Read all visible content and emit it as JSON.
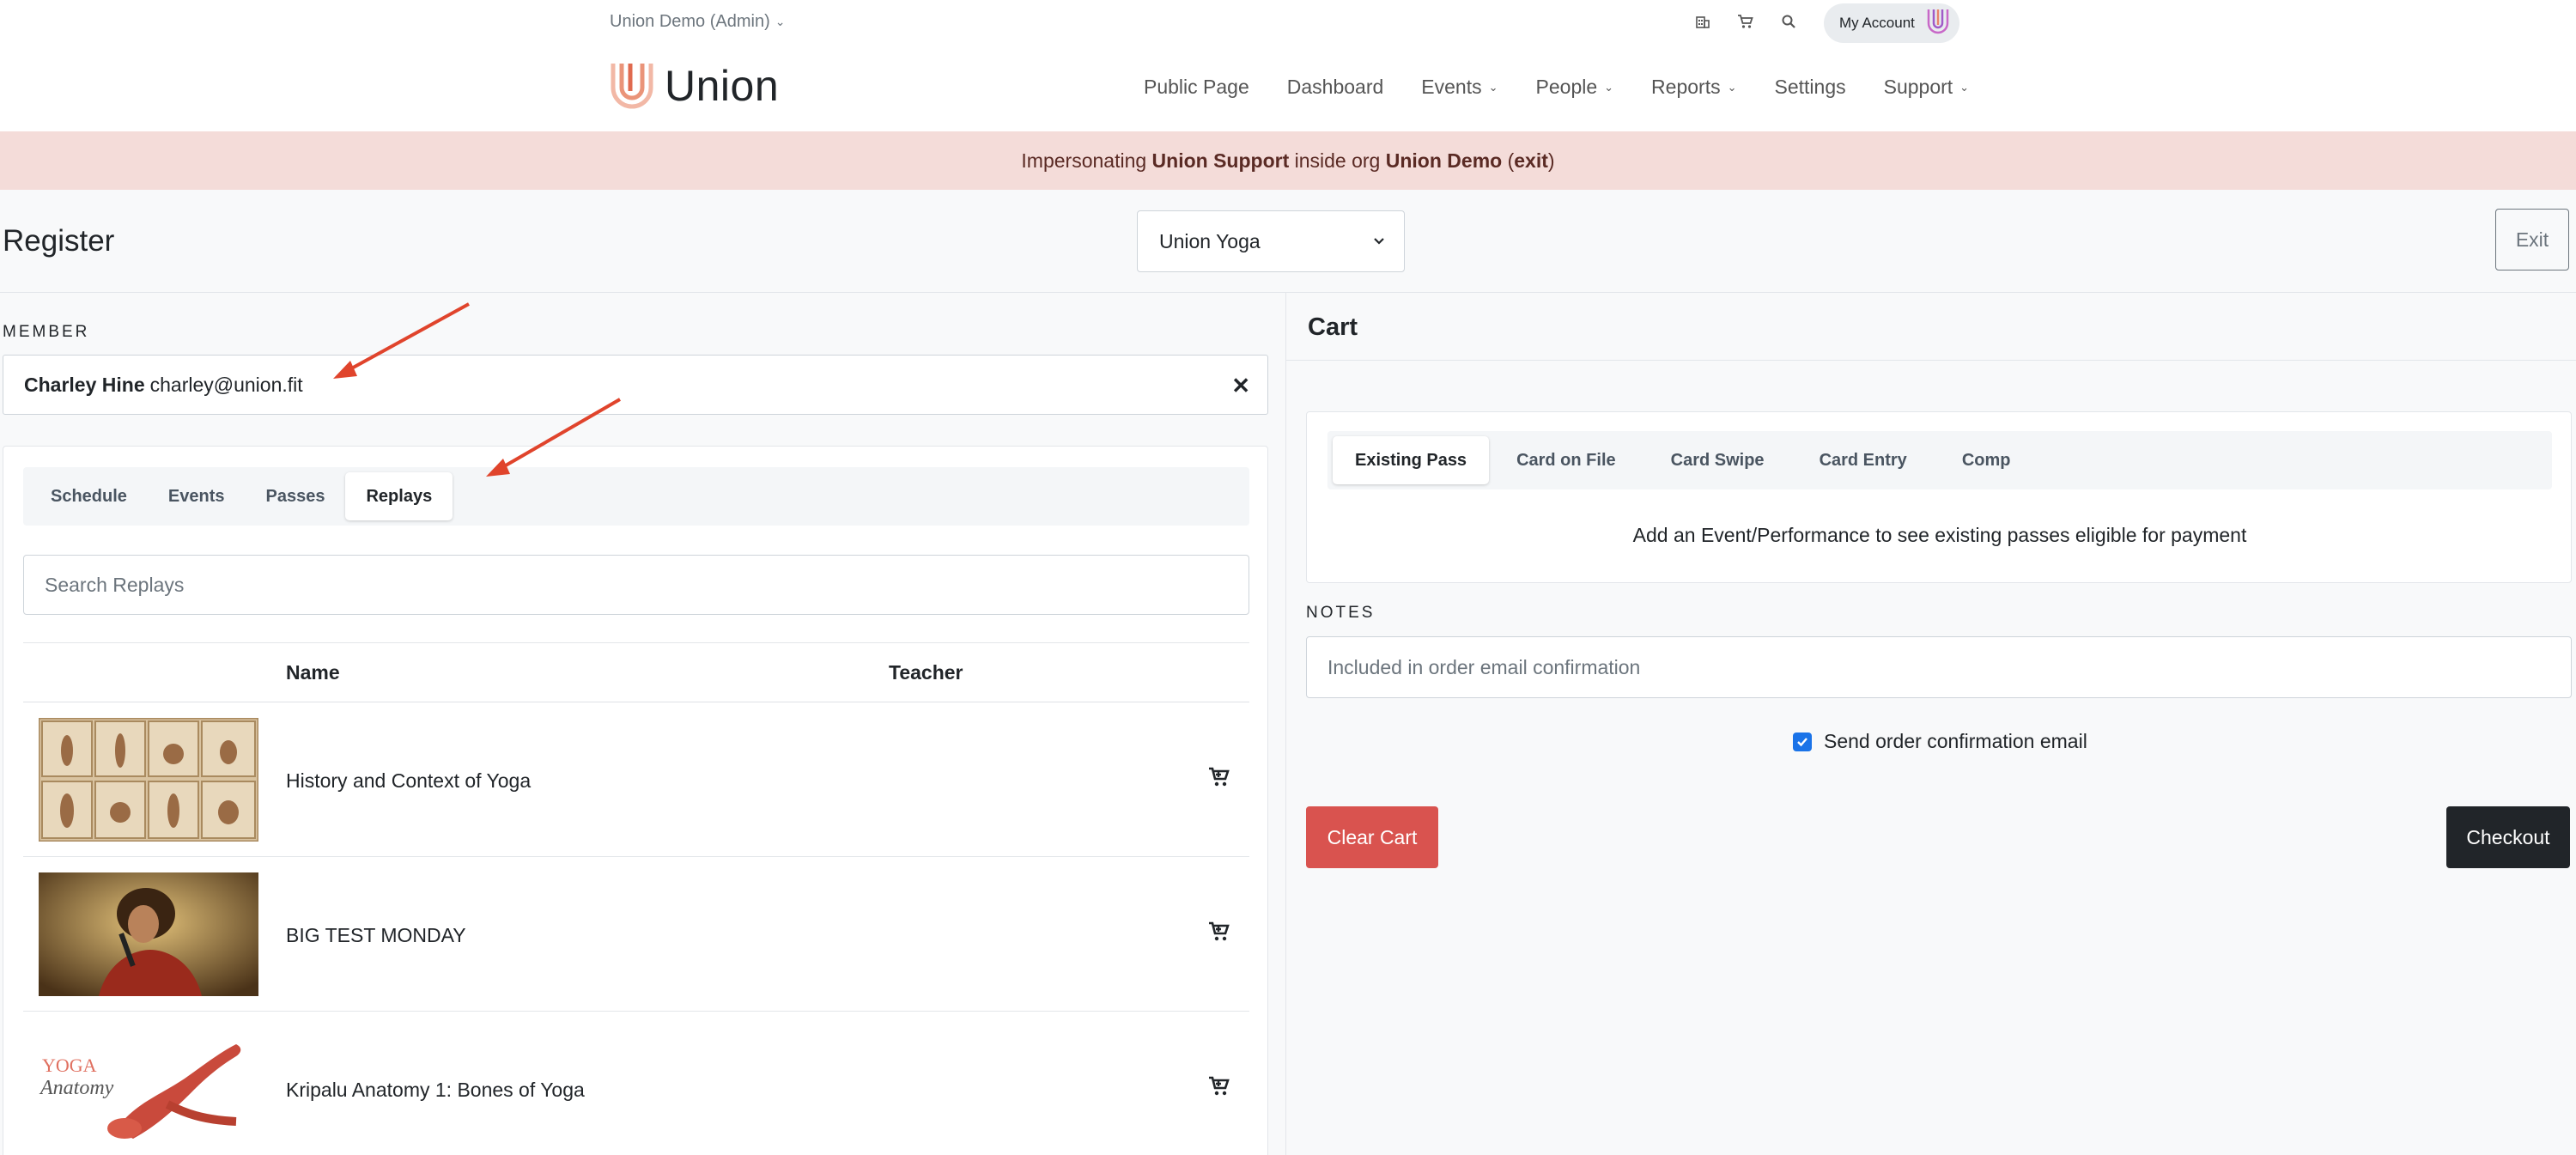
{
  "header": {
    "org_switcher": "Union Demo (Admin)",
    "account_label": "My Account",
    "logo_text": "Union",
    "nav": [
      {
        "label": "Public Page",
        "dropdown": false
      },
      {
        "label": "Dashboard",
        "dropdown": false
      },
      {
        "label": "Events",
        "dropdown": true
      },
      {
        "label": "People",
        "dropdown": true
      },
      {
        "label": "Reports",
        "dropdown": true
      },
      {
        "label": "Settings",
        "dropdown": false
      },
      {
        "label": "Support",
        "dropdown": true
      }
    ],
    "icons": [
      "building-icon",
      "cart-icon",
      "search-icon"
    ]
  },
  "banner": {
    "prefix": "Impersonating ",
    "user": "Union Support",
    "middle": " inside org ",
    "org": "Union Demo",
    "open_paren": " (",
    "exit": "exit",
    "close_paren": ")"
  },
  "register": {
    "title": "Register",
    "studio": "Union Yoga",
    "exit_label": "Exit"
  },
  "member": {
    "label": "MEMBER",
    "name": "Charley Hine",
    "email": "charley@union.fit"
  },
  "catalog": {
    "tabs": [
      "Schedule",
      "Events",
      "Passes",
      "Replays"
    ],
    "active_tab": "Replays",
    "search_placeholder": "Search Replays",
    "columns": {
      "name": "Name",
      "teacher": "Teacher"
    },
    "rows": [
      {
        "name": "History and Context of Yoga",
        "teacher": ""
      },
      {
        "name": "BIG TEST MONDAY",
        "teacher": ""
      },
      {
        "name": "Kripalu Anatomy 1: Bones of Yoga",
        "teacher": ""
      }
    ],
    "thumb3_text": {
      "line1": "YOGA",
      "line2": "Anatomy"
    }
  },
  "cart": {
    "title": "Cart",
    "payment_tabs": [
      "Existing Pass",
      "Card on File",
      "Card Swipe",
      "Card Entry",
      "Comp"
    ],
    "active_payment_tab": "Existing Pass",
    "message": "Add an Event/Performance to see existing passes eligible for payment",
    "notes_label": "NOTES",
    "notes_placeholder": "Included in order email confirmation",
    "send_confirmation_label": "Send order confirmation email",
    "send_confirmation_checked": true,
    "clear_label": "Clear Cart",
    "checkout_label": "Checkout"
  },
  "colors": {
    "banner_bg": "#f4dcd9",
    "clear_button": "#d9534f",
    "checkout_button": "#212529",
    "annotation_arrow": "#e0442c",
    "logo": "#e8836c"
  }
}
